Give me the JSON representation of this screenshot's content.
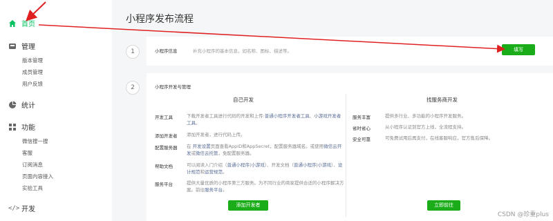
{
  "sidebar": {
    "home": {
      "label": "首页",
      "icon": "home-icon"
    },
    "manage": {
      "label": "管理",
      "icon": "inbox-icon",
      "items": [
        "版本管理",
        "成员管理",
        "用户反馈"
      ]
    },
    "stats": {
      "label": "统计",
      "icon": "pie-chart-icon"
    },
    "features": {
      "label": "功能",
      "icon": "grid-icon",
      "items": [
        "微信搜一搜",
        "客服",
        "订阅消息",
        "页面内容接入",
        "实验工具"
      ]
    },
    "dev": {
      "label": "开发",
      "icon": "code-icon"
    }
  },
  "main": {
    "title": "小程序发布流程",
    "step1": {
      "number": "1",
      "label": "小程序信息",
      "desc": "补充小程序的基本信息，如名称、图标、描述等。",
      "button": "填写"
    },
    "step2": {
      "number": "2",
      "label": "小程序开发与管理",
      "left": {
        "heading": "自己开发",
        "rows": [
          {
            "label": "开发工具",
            "text_a": "下载开发者工具进行代码的开发和上传:",
            "link_a": "普通小程序开发者工具",
            "text_b": "、",
            "link_b": "小游戏开发者工具",
            "text_c": "。"
          },
          {
            "label": "添加开发者",
            "text": "添加开发者，进行代码上传。"
          },
          {
            "label": "配置服务器",
            "text_a": "在",
            "link_a": "开发设置",
            "text_b": "页面查看AppID和AppSecret，配置服务器域名。或使用",
            "link_b": "微信云开发",
            "text_c": "或",
            "link_c": "微信云托管",
            "text_d": "，免配置服务器。"
          },
          {
            "label": "帮助文档",
            "text_a": "可以阅读入门介绍（",
            "link_a": "普通小程序",
            "text_b": "|",
            "link_b": "小游戏",
            "text_c": "）、开发文档（",
            "link_c": "普通小程序",
            "text_d": "|",
            "link_d": "小游戏",
            "text_e": "）、",
            "link_e": "设计规范",
            "text_f": "和",
            "link_f": "运营规范",
            "text_g": "。"
          },
          {
            "label": "服务平台",
            "text_a": "提供大量优质的小程序第三方服务。为不同行业的商家提供合适的小程序解决方案。前往",
            "link_a": "服务平台",
            "text_b": "。"
          }
        ],
        "button": "添加开发者"
      },
      "right": {
        "heading": "找服务商开发",
        "rows": [
          {
            "label": "服务丰富",
            "text": "提供多行业、多功能的小程序开发服务。"
          },
          {
            "label": "省时省心",
            "text": "从小程序认证到官方上线，全流程支持。"
          },
          {
            "label": "安全可靠",
            "text": "可免费试用后再支付，在线客服响应，官方售后保障。"
          }
        ],
        "button": "立即前往"
      }
    }
  },
  "watermark": "CSDN @珍重plus",
  "colors": {
    "accent": "#07c160",
    "button": "#1aad19",
    "annotation": "#e02020",
    "link": "#576b95"
  }
}
